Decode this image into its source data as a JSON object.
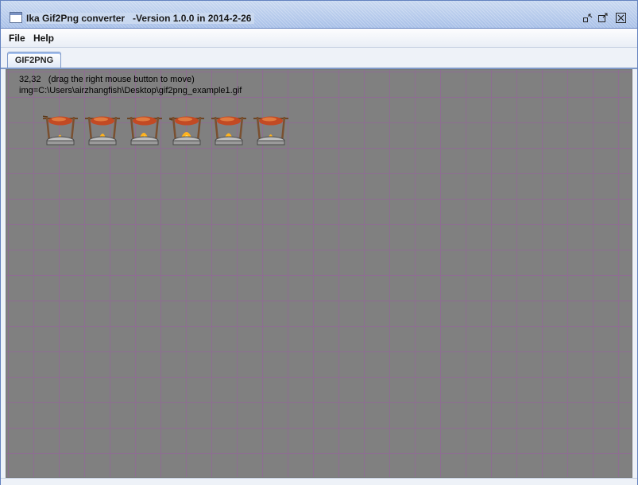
{
  "window": {
    "title": "Ika Gif2Png converter   -Version 1.0.0 in 2014-2-26"
  },
  "menubar": {
    "items": [
      {
        "label": "File"
      },
      {
        "label": "Help"
      }
    ]
  },
  "tabs": [
    {
      "label": "GIF2PNG",
      "selected": true
    }
  ],
  "canvas": {
    "coords_text": "32,32   (drag the right mouse button to move)",
    "image_text": "img=C:\\Users\\airzhangfish\\Desktop\\gif2png_example1.gif",
    "background_color": "#808080",
    "grid_color": "#8e6d92",
    "frame_count": 6
  }
}
